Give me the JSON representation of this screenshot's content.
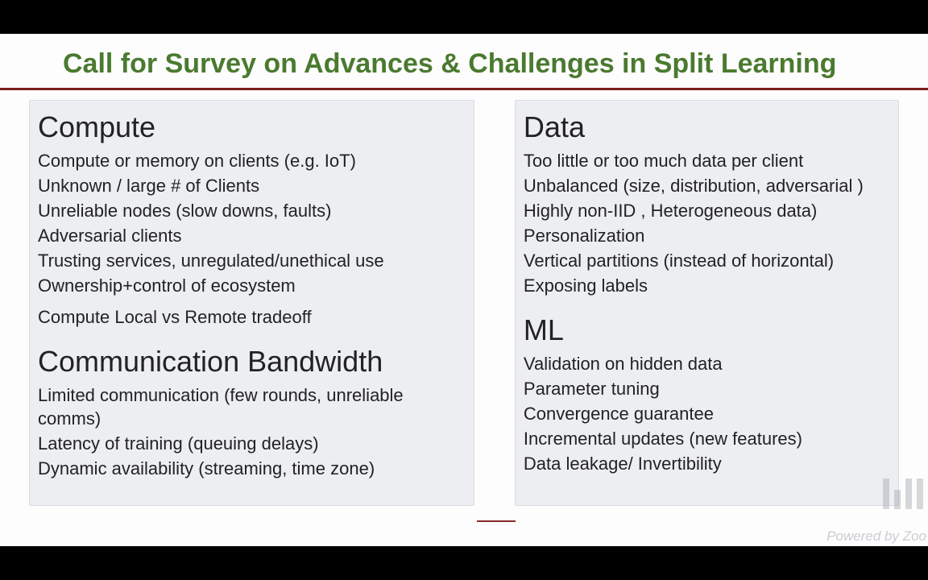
{
  "title": "Call for Survey on Advances & Challenges in Split Learning",
  "left": {
    "compute": {
      "heading": "Compute",
      "items": [
        "Compute or memory on clients (e.g. IoT)",
        "Unknown / large # of Clients",
        "Unreliable nodes (slow downs, faults)",
        "Adversarial clients",
        "Trusting services, unregulated/unethical use",
        "Ownership+control of ecosystem",
        "Compute Local vs Remote tradeoff"
      ]
    },
    "bandwidth": {
      "heading": "Communication Bandwidth",
      "items": [
        "Limited communication (few rounds, unreliable comms)",
        "Latency of training (queuing delays)",
        "Dynamic availability (streaming, time zone)"
      ]
    }
  },
  "right": {
    "data": {
      "heading": "Data",
      "items": [
        "Too little or too much data per client",
        "Unbalanced (size, distribution, adversarial )",
        "Highly non-IID , Heterogeneous data)",
        "Personalization",
        "Vertical partitions (instead of horizontal)",
        "Exposing labels"
      ]
    },
    "ml": {
      "heading": "ML",
      "items": [
        "Validation on hidden data",
        "Parameter tuning",
        "Convergence guarantee",
        "Incremental updates (new features)",
        "Data leakage/ Invertibility"
      ]
    }
  },
  "watermark": "Powered by Zoo"
}
